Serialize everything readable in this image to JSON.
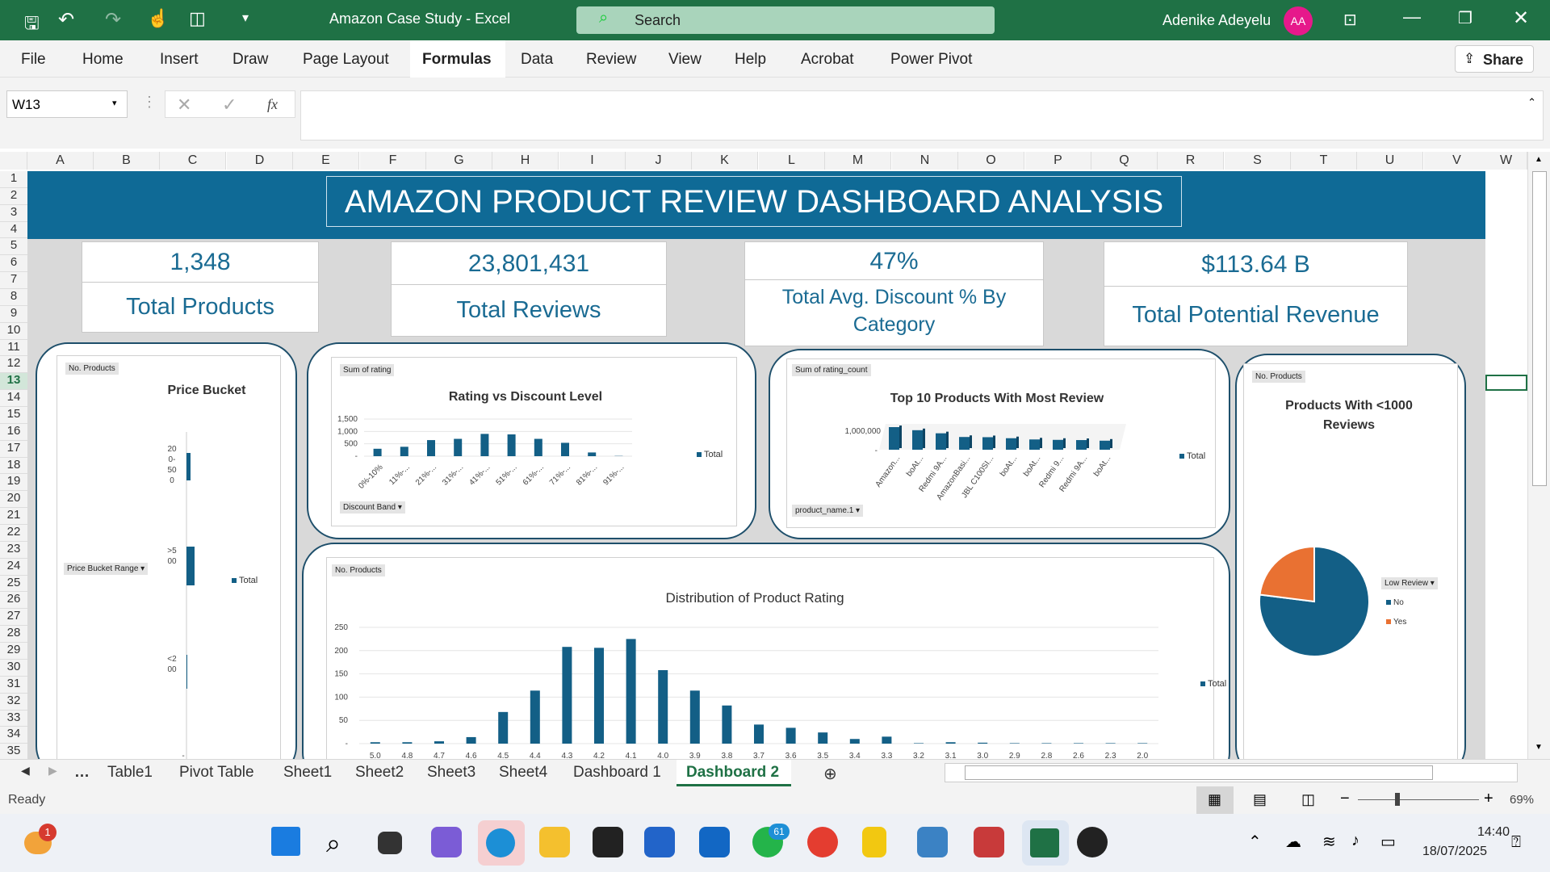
{
  "window": {
    "title": "Amazon Case Study - Excel",
    "search_placeholder": "Search",
    "user_name": "Adenike Adeyelu",
    "user_initials": "AA"
  },
  "ribbon": {
    "tabs": [
      "File",
      "Home",
      "Insert",
      "Draw",
      "Page Layout",
      "Formulas",
      "Data",
      "Review",
      "View",
      "Help",
      "Acrobat",
      "Power Pivot"
    ],
    "active_tab": "Formulas",
    "share_label": "Share"
  },
  "formula_bar": {
    "name_box": "W13",
    "fx": "fx",
    "content": ""
  },
  "columns": [
    "A",
    "B",
    "C",
    "D",
    "E",
    "F",
    "G",
    "H",
    "I",
    "J",
    "K",
    "L",
    "M",
    "N",
    "O",
    "P",
    "Q",
    "R",
    "S",
    "T",
    "U",
    "V",
    "W"
  ],
  "rows": [
    "1",
    "2",
    "3",
    "4",
    "5",
    "6",
    "7",
    "8",
    "9",
    "10",
    "11",
    "12",
    "13",
    "14",
    "15",
    "16",
    "17",
    "18",
    "19",
    "20",
    "21",
    "22",
    "23",
    "24",
    "25",
    "26",
    "27",
    "28",
    "29",
    "30",
    "31",
    "32",
    "33",
    "34",
    "35"
  ],
  "dashboard": {
    "title": "AMAZON PRODUCT REVIEW DASHBOARD ANALYSIS",
    "kpis": [
      {
        "value": "1,348",
        "label": "Total Products"
      },
      {
        "value": "23,801,431",
        "label": "Total Reviews"
      },
      {
        "value": "47%",
        "label": "Total Avg. Discount % By Category"
      },
      {
        "value": "$113.64 B",
        "label": "Total Potential Revenue"
      }
    ]
  },
  "colors": {
    "bar": "#135f86",
    "orange": "#e97132",
    "banner": "#0f6a96",
    "excel_green": "#1f7145"
  },
  "chart_data": [
    {
      "type": "bar",
      "title": "Price Bucket",
      "field_button": "No. Products",
      "axis_button": "Price Bucket Range",
      "legend": "Total",
      "categories": [
        "200-500",
        ">500",
        "<200"
      ],
      "values": [
        60,
        120,
        1
      ]
    },
    {
      "type": "bar",
      "title": "Rating vs Discount Level",
      "field_button": "Sum of rating",
      "axis_button": "Discount Band",
      "legend": "Total",
      "categories": [
        "0%-10%",
        "11%-...",
        "21%-...",
        "31%-...",
        "41%-...",
        "51%-...",
        "61%-...",
        "71%-...",
        "81%-...",
        "91%-..."
      ],
      "values": [
        300,
        380,
        650,
        700,
        900,
        880,
        700,
        540,
        150,
        10
      ],
      "y_ticks": [
        "1,500",
        "1,000",
        "500",
        "-"
      ],
      "ylim": [
        0,
        1500
      ]
    },
    {
      "type": "bar",
      "title": "Top 10 Products With Most Review",
      "field_button": "Sum of rating_count",
      "axis_button": "product_name.1",
      "legend": "Total",
      "categories": [
        "Amazon...",
        "boAt...",
        "Redmi 9A...",
        "AmazonBasi...",
        "JBL C100SI...",
        "boAt...",
        "boAt...",
        "Redmi 9...",
        "Redmi 9A...",
        "boAt..."
      ],
      "values": [
        1100000,
        950000,
        800000,
        620000,
        610000,
        560000,
        500000,
        480000,
        470000,
        440000
      ],
      "y_ticks": [
        "1,000,000",
        "-"
      ]
    },
    {
      "type": "pie",
      "title": "Products With <1000 Reviews",
      "field_button": "No. Products",
      "legend_button": "Low Review",
      "categories": [
        "No",
        "Yes"
      ],
      "values": [
        77,
        23
      ]
    },
    {
      "type": "bar",
      "title": "Distribution of Product Rating",
      "field_button": "No. Products",
      "legend": "Total",
      "categories": [
        "5.0",
        "4.8",
        "4.7",
        "4.6",
        "4.5",
        "4.4",
        "4.3",
        "4.2",
        "4.1",
        "4.0",
        "3.9",
        "3.8",
        "3.7",
        "3.6",
        "3.5",
        "3.4",
        "3.3",
        "3.2",
        "3.1",
        "3.0",
        "2.9",
        "2.8",
        "2.6",
        "2.3",
        "2.0"
      ],
      "values": [
        3,
        3,
        5,
        14,
        68,
        114,
        208,
        206,
        225,
        158,
        114,
        82,
        41,
        34,
        24,
        10,
        15,
        1,
        3,
        2,
        1,
        1,
        1,
        1,
        1
      ],
      "y_ticks": [
        "250",
        "200",
        "150",
        "100",
        "50",
        "-"
      ],
      "ylim": [
        0,
        250
      ]
    }
  ],
  "sheet_tabs": [
    "Table1",
    "Pivot Table",
    "Sheet1",
    "Sheet2",
    "Sheet3",
    "Sheet4",
    "Dashboard 1",
    "Dashboard 2"
  ],
  "active_sheet": "Dashboard 2",
  "status": {
    "ready": "Ready",
    "zoom": "69%"
  },
  "taskbar": {
    "time": "14:40",
    "date": "18/07/2025",
    "weather_badge": "1",
    "whatsapp_badge": "61"
  }
}
